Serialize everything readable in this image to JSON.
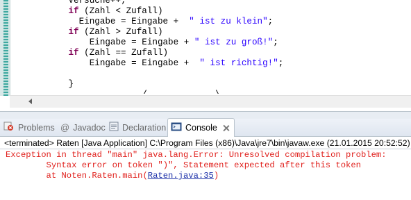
{
  "editor": {
    "lines": {
      "l1": "Versuche++;",
      "l2_kw": "if",
      "l2_rest": " (Zahl < Zufall)",
      "l3": "  Eingabe = Eingabe +  ",
      "l3_str": "\" ist zu klein\"",
      "l3_end": ";",
      "l4_kw": "if",
      "l4_rest": " (Zahl > Zufall)",
      "l5": "    Eingabe = Eingabe + ",
      "l5_str": "\" ist zu groß!\"",
      "l5_end": ";",
      "l6_kw": "if",
      "l6_rest": " (Zahl == Zufall)",
      "l7": "    Eingabe = Eingabe +  ",
      "l7_str": "\" ist richtig!\"",
      "l7_end": ";",
      "l8": "",
      "l9": "}",
      "l10": "    _  .  /_       .    \\"
    }
  },
  "tabs": {
    "problems": "Problems",
    "javadoc": "Javadoc",
    "declaration": "Declaration",
    "console": "Console"
  },
  "console": {
    "terminated": "<terminated> Raten [Java Application] C:\\Program Files (x86)\\Java\\jre7\\bin\\javaw.exe (21.01.2015 20:52:52)",
    "error_line1": "Exception in thread \"main\" java.lang.Error: Unresolved compilation problem: ",
    "error_line2": "\tSyntax error on token \")\", Statement expected after this token",
    "error_line3": "",
    "stack_prefix": "\tat Noten.Raten.main(",
    "stack_link": "Raten.java:35",
    "stack_suffix": ")"
  },
  "colors": {
    "keyword": "#7f0055",
    "string": "#2a00ff",
    "error": "#e0201c",
    "link": "#1b2fa8"
  }
}
